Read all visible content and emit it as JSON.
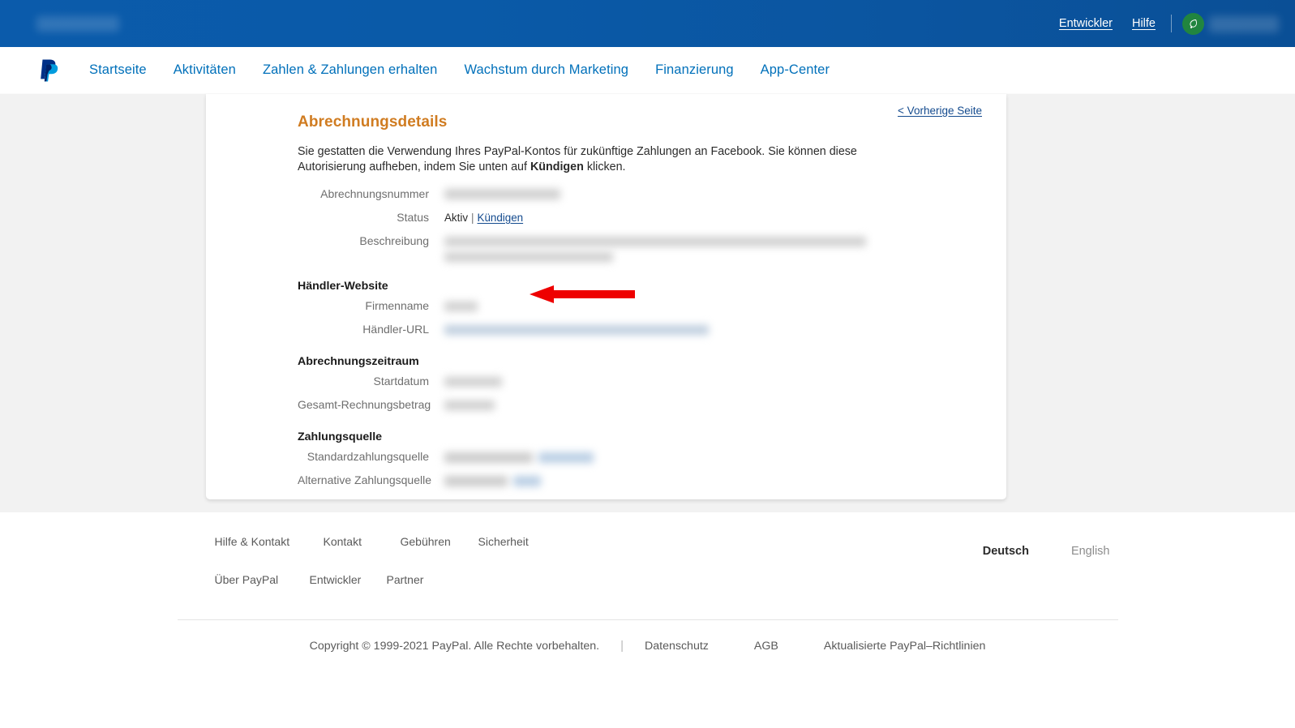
{
  "topbar": {
    "merchant_blur": "",
    "links": [
      {
        "label": "Entwickler",
        "name": "developer"
      },
      {
        "label": "Hilfe",
        "name": "help"
      }
    ],
    "avatar_icon": "leaf-avatar-icon",
    "user_blur": ""
  },
  "nav": {
    "logo_icon": "paypal-logo-icon",
    "items": [
      {
        "label": "Startseite",
        "name": "home"
      },
      {
        "label": "Aktivitäten",
        "name": "activity"
      },
      {
        "label": "Zahlen & Zahlungen erhalten",
        "name": "pay-and-get-paid"
      },
      {
        "label": "Wachstum durch Marketing",
        "name": "marketing-growth"
      },
      {
        "label": "Finanzierung",
        "name": "financing"
      },
      {
        "label": "App-Center",
        "name": "app-center"
      }
    ]
  },
  "card": {
    "title": "Abrechnungsdetails",
    "previous_page_link": "< Vorherige Seite",
    "intro_part1": "Sie gestatten die Verwendung Ihres PayPal-Kontos für zukünftige Zahlungen an Facebook. Sie können diese Autorisierung aufheben, indem Sie unten auf ",
    "intro_bold": "Kündigen",
    "intro_part2": " klicken.",
    "fields": {
      "billing_number_label": "Abrechnungsnummer",
      "status_label": "Status",
      "status_value": "Aktiv",
      "status_separator": "|",
      "cancel_link": "Kündigen",
      "description_label": "Beschreibung"
    },
    "merchant_section": {
      "heading": "Händler-Website",
      "company_name_label": "Firmenname",
      "merchant_url_label": "Händler-URL"
    },
    "billing_period_section": {
      "heading": "Abrechnungszeitraum",
      "start_date_label": "Startdatum",
      "total_amount_label": "Gesamt-Rechnungsbetrag"
    },
    "payment_source_section": {
      "heading": "Zahlungsquelle",
      "default_source_label": "Standardzahlungsquelle",
      "alternative_source_label": "Alternative Zahlungsquelle"
    }
  },
  "annotation": {
    "arrow_icon": "red-left-arrow-icon",
    "arrow_color": "#ee0000"
  },
  "footer": {
    "row1": [
      {
        "label": "Hilfe & Kontakt",
        "name": "help-and-contact"
      },
      {
        "label": "Kontakt",
        "name": "contact"
      },
      {
        "label": "Gebühren",
        "name": "fees"
      },
      {
        "label": "Sicherheit",
        "name": "security"
      }
    ],
    "row2": [
      {
        "label": "Über PayPal",
        "name": "about-paypal"
      },
      {
        "label": "Entwickler",
        "name": "developer"
      },
      {
        "label": "Partner",
        "name": "partner"
      }
    ],
    "language": {
      "active": "Deutsch",
      "inactive": "English"
    },
    "copyright": "Copyright © 1999-2021 PayPal. Alle Rechte vorbehalten.",
    "copy_divider": "|",
    "legal_links": [
      {
        "label": "Datenschutz",
        "name": "privacy"
      },
      {
        "label": "AGB",
        "name": "terms"
      },
      {
        "label": "Aktualisierte PayPal–Richtlinien",
        "name": "updated-policies"
      }
    ]
  },
  "colors": {
    "paypal_blue": "#0070ba",
    "topbar_blue": "#0b5bab",
    "title_orange": "#d07c21",
    "link_blue": "#134a8e",
    "badge_green": "#21853f"
  }
}
